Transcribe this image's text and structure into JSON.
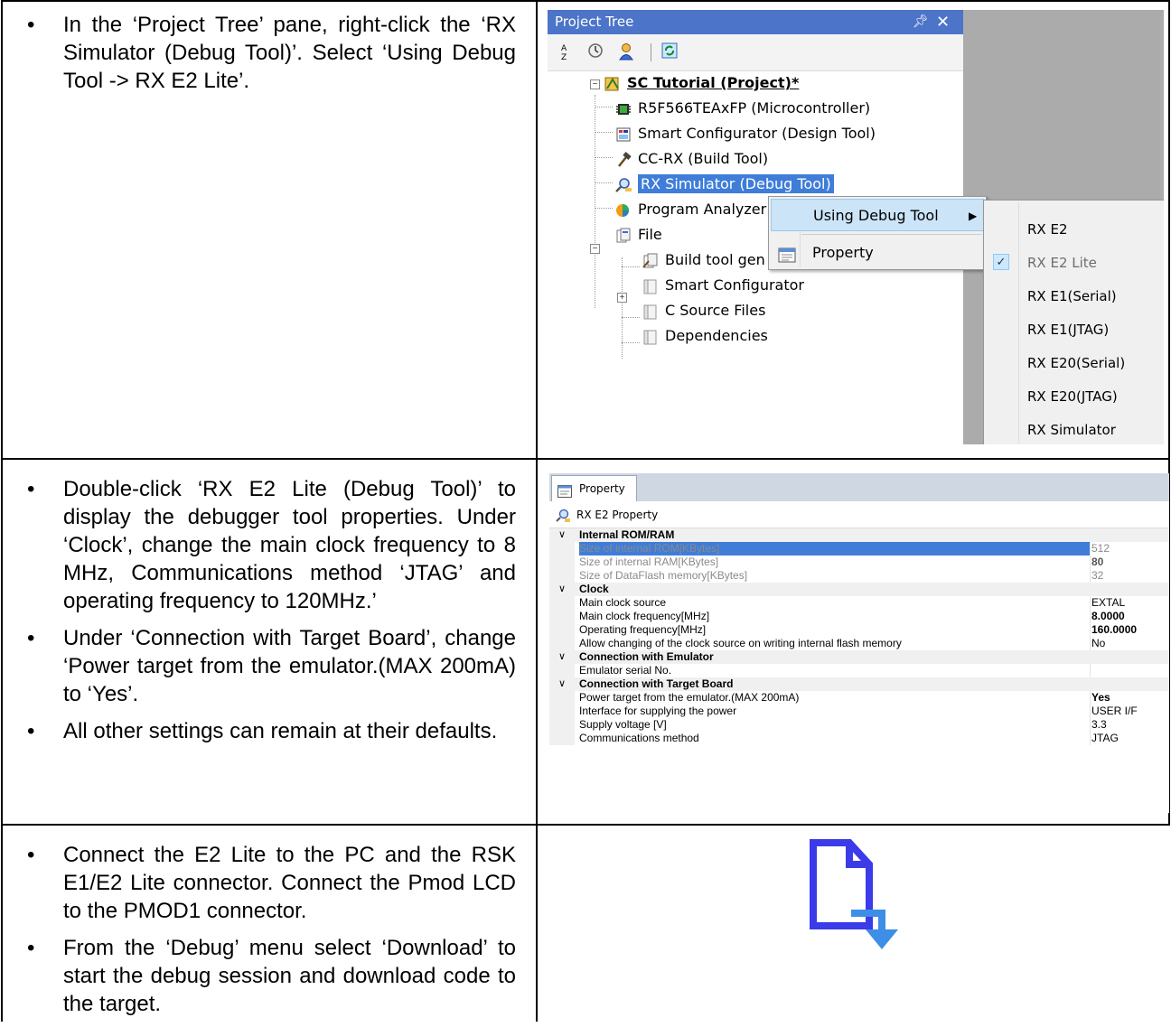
{
  "rows": [
    {
      "bullets": [
        "In the ‘Project Tree’ pane, right-click the ‘RX Simulator (Debug Tool)’.   Select ‘Using Debug Tool -> RX E2 Lite’."
      ]
    },
    {
      "bullets": [
        "Double-click ‘RX E2 Lite (Debug Tool)’ to display the debugger tool properties. Under ‘Clock’, change the main clock frequency to 8 MHz, Communications method ‘JTAG’ and operating frequency to 120MHz.’",
        "Under ‘Connection with Target Board’, change ‘Power target from the emulator.(MAX 200mA) to ‘Yes’.",
        "All other settings can remain at their defaults."
      ]
    },
    {
      "bullets": [
        "Connect the E2 Lite to the PC and the RSK E1/E2 Lite connector.  Connect the Pmod LCD to the PMOD1 connector.",
        "From the ‘Debug’ menu select ‘Download’ to start the debug session and download code to the target."
      ]
    }
  ],
  "project_tree": {
    "title": "Project Tree",
    "pin_glyph": "ᵖ",
    "close_glyph": "✕",
    "nodes": {
      "project": "SC Tutorial (Project)*",
      "mcu": "R5F566TEAxFP (Microcontroller)",
      "smartcfg": "Smart Configurator (Design Tool)",
      "ccrx": "CC-RX (Build Tool)",
      "rxsim": "RX Simulator (Debug Tool)",
      "analyzer": "Program Analyzer",
      "file": "File",
      "buildtool": "Build tool gen",
      "sc_folder": "Smart Configurator",
      "csrc": "C Source Files",
      "deps": "Dependencies"
    },
    "context_menu": {
      "using_debug_tool": "Using Debug Tool",
      "arrow": "▶",
      "property": "Property"
    },
    "submenu": {
      "items": [
        "RX E2",
        "RX E2 Lite",
        "RX E1(Serial)",
        "RX E1(JTAG)",
        "RX E20(Serial)",
        "RX E20(JTAG)",
        "RX Simulator"
      ],
      "checked_index": 1,
      "check_glyph": "✓"
    }
  },
  "property_panel": {
    "tab_label": "Property",
    "header": "RX E2 Property",
    "chevron": "∨",
    "categories": {
      "rom_ram": "Internal ROM/RAM",
      "clock": "Clock",
      "emulator": "Connection with Emulator",
      "target": "Connection with Target Board"
    },
    "items": {
      "rom_size": {
        "name": "Size of internal ROM[KBytes]",
        "value": "512"
      },
      "ram_size": {
        "name": "Size of internal RAM[KBytes]",
        "value": "80"
      },
      "df_size": {
        "name": "Size of DataFlash memory[KBytes]",
        "value": "32"
      },
      "clk_src": {
        "name": "Main clock source",
        "value": "EXTAL"
      },
      "clk_freq": {
        "name": "Main clock frequency[MHz]",
        "value": "8.0000"
      },
      "op_freq": {
        "name": "Operating frequency[MHz]",
        "value": "160.0000"
      },
      "allow_chg": {
        "name": "Allow changing of the clock source on writing internal flash memory",
        "value": "No"
      },
      "emu_serial": {
        "name": "Emulator serial No.",
        "value": ""
      },
      "power": {
        "name": "Power target from the emulator.(MAX 200mA)",
        "value": "Yes"
      },
      "iface": {
        "name": "Interface for supplying the power",
        "value": "USER I/F"
      },
      "voltage": {
        "name": "Supply voltage [V]",
        "value": "3.3"
      },
      "comm": {
        "name": "Communications method",
        "value": "JTAG"
      }
    }
  },
  "colors": {
    "title_bar": "#4c74c8",
    "selection": "#3f7dd9",
    "download_blue": "#3b3bea",
    "download_arrow": "#3d8ee6"
  }
}
